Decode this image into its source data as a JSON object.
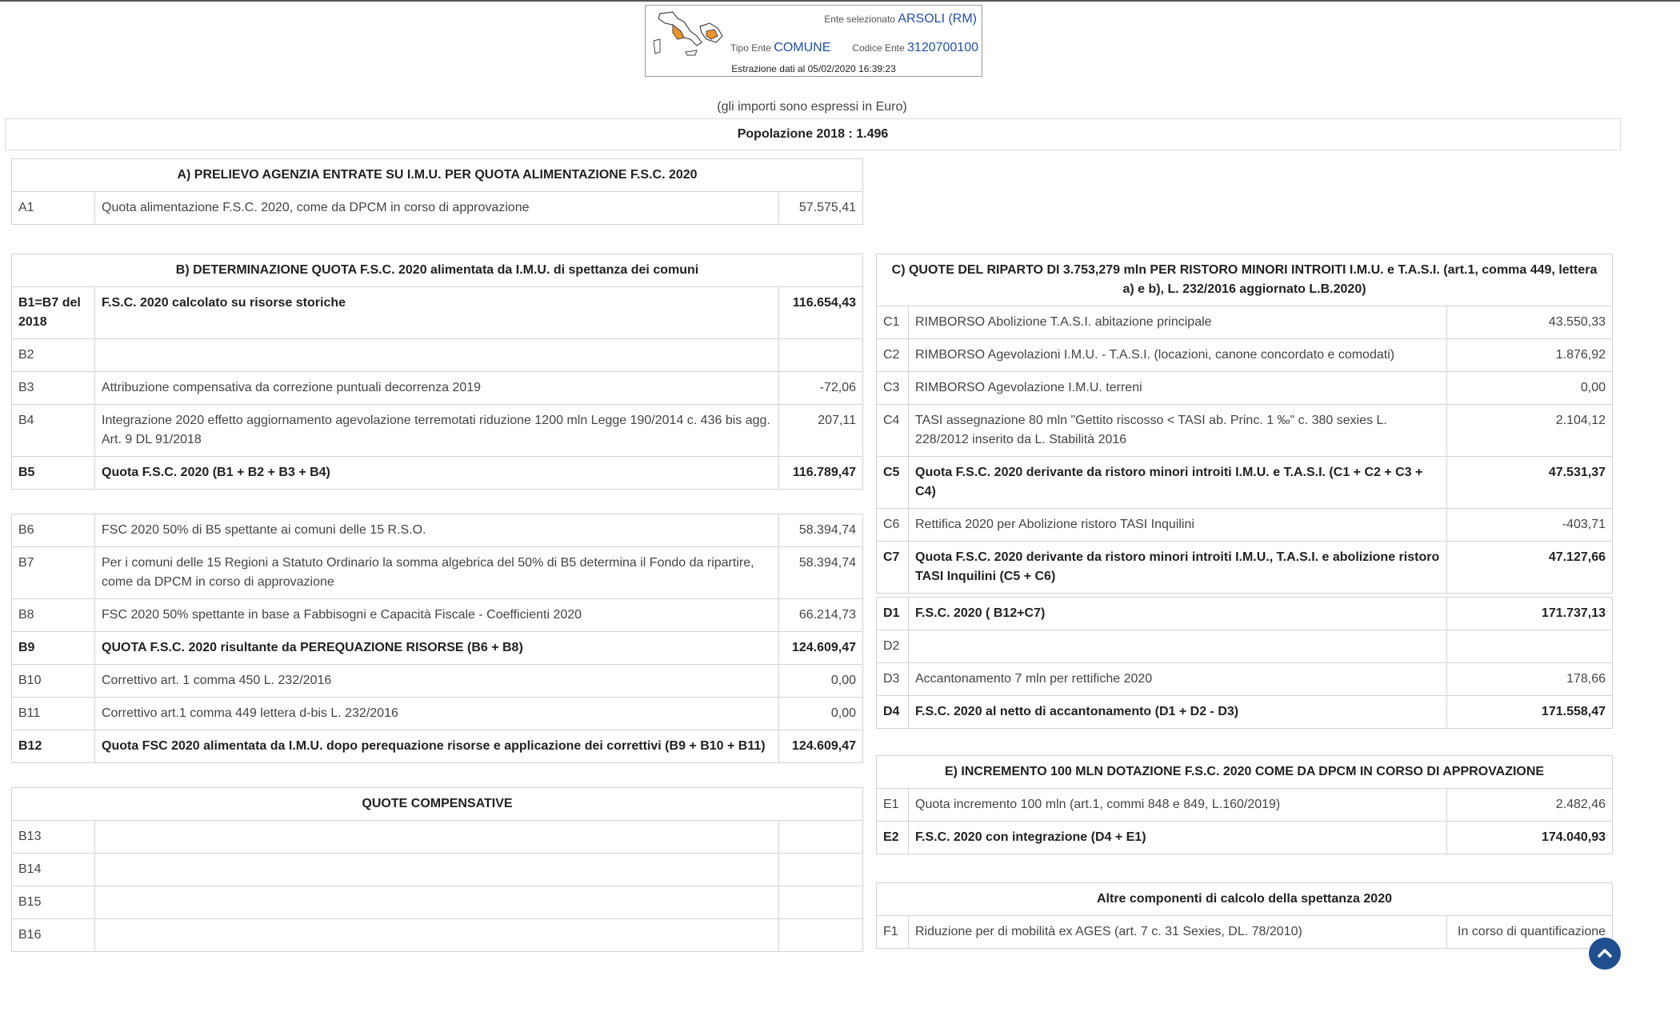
{
  "header": {
    "ente_label": "Ente selezionato",
    "ente_value": "ARSOLI (RM)",
    "tipo_label": "Tipo Ente",
    "tipo_value": "COMUNE",
    "codice_label": "Codice Ente",
    "codice_value": "3120700100",
    "estrazione": "Estrazione dati al 05/02/2020 16:39:23"
  },
  "note": "(gli importi sono espressi in Euro)",
  "popolazione": "Popolazione 2018 : 1.496",
  "section_a": {
    "title": "A) PRELIEVO AGENZIA ENTRATE SU I.M.U. PER QUOTA ALIMENTAZIONE F.S.C. 2020",
    "rows": [
      {
        "code": "A1",
        "desc": "Quota alimentazione F.S.C. 2020, come da DPCM in corso di approvazione",
        "value": "57.575,41"
      }
    ]
  },
  "section_b": {
    "title": "B) DETERMINAZIONE QUOTA F.S.C. 2020 alimentata da I.M.U. di spettanza dei comuni",
    "rows": [
      {
        "code": "B1=B7 del 2018",
        "desc": "F.S.C. 2020 calcolato su risorse storiche",
        "value": "116.654,43"
      },
      {
        "code": "B2",
        "desc": "",
        "value": ""
      },
      {
        "code": "B3",
        "desc": "Attribuzione compensativa da correzione puntuali decorrenza 2019",
        "value": "-72,06"
      },
      {
        "code": "B4",
        "desc": "Integrazione 2020 effetto aggiornamento agevolazione terremotati riduzione 1200 mln Legge 190/2014 c. 436 bis agg. Art. 9 DL 91/2018",
        "value": "207,11"
      },
      {
        "code": "B5",
        "desc": "Quota F.S.C. 2020 (B1 + B2 + B3 + B4)",
        "value": "116.789,47"
      },
      {
        "code": "B6",
        "desc": "FSC 2020 50% di B5 spettante ai comuni delle 15 R.S.O.",
        "value": "58.394,74"
      },
      {
        "code": "B7",
        "desc": "Per i comuni delle 15 Regioni a Statuto Ordinario la somma algebrica del 50% di B5 determina il Fondo da ripartire, come da DPCM in corso di approvazione",
        "value": "58.394,74"
      },
      {
        "code": "B8",
        "desc": "FSC 2020 50% spettante in base a Fabbisogni e Capacità Fiscale - Coefficienti 2020",
        "value": "66.214,73"
      },
      {
        "code": "B9",
        "desc": "QUOTA F.S.C. 2020 risultante da PEREQUAZIONE RISORSE (B6 + B8)",
        "value": "124.609,47"
      },
      {
        "code": "B10",
        "desc": "Correttivo art. 1 comma 450 L. 232/2016",
        "value": "0,00"
      },
      {
        "code": "B11",
        "desc": "Correttivo art.1 comma 449 lettera d-bis L. 232/2016",
        "value": "0,00"
      },
      {
        "code": "B12",
        "desc": "Quota FSC 2020 alimentata da I.M.U. dopo perequazione risorse e applicazione dei correttivi (B9 + B10 + B11)",
        "value": "124.609,47"
      }
    ]
  },
  "section_qc": {
    "title": "QUOTE COMPENSATIVE",
    "rows": [
      {
        "code": "B13",
        "desc": "",
        "value": ""
      },
      {
        "code": "B14",
        "desc": "",
        "value": ""
      },
      {
        "code": "B15",
        "desc": "",
        "value": ""
      },
      {
        "code": "B16",
        "desc": "",
        "value": ""
      }
    ]
  },
  "section_c": {
    "title": "C) QUOTE DEL RIPARTO DI 3.753,279 mln PER RISTORO MINORI INTROITI I.M.U. e T.A.S.I. (art.1, comma 449, lettera a) e b), L. 232/2016 aggiornato L.B.2020)",
    "rows": [
      {
        "code": "C1",
        "desc": "RIMBORSO Abolizione T.A.S.I. abitazione principale",
        "value": "43.550,33"
      },
      {
        "code": "C2",
        "desc": "RIMBORSO Agevolazioni I.M.U. - T.A.S.I. (locazioni, canone concordato e comodati)",
        "value": "1.876,92"
      },
      {
        "code": "C3",
        "desc": "RIMBORSO Agevolazione I.M.U. terreni",
        "value": "0,00"
      },
      {
        "code": "C4",
        "desc": "TASI assegnazione 80 mln \"Gettito riscosso < TASI ab. Princ. 1 ‰\" c. 380 sexies L. 228/2012 inserito da L. Stabilità 2016",
        "value": "2.104,12"
      },
      {
        "code": "C5",
        "desc": "Quota F.S.C. 2020 derivante da ristoro minori introiti I.M.U. e T.A.S.I. (C1 + C2 + C3 + C4)",
        "value": "47.531,37"
      },
      {
        "code": "C6",
        "desc": "Rettifica 2020 per Abolizione ristoro TASI Inquilini",
        "value": "-403,71"
      },
      {
        "code": "C7",
        "desc": "Quota F.S.C. 2020 derivante da ristoro minori introiti I.M.U., T.A.S.I. e abolizione ristoro TASI Inquilini (C5 + C6)",
        "value": "47.127,66"
      }
    ]
  },
  "section_d": {
    "rows": [
      {
        "code": "D1",
        "desc": "F.S.C. 2020 ( B12+C7)",
        "value": "171.737,13"
      },
      {
        "code": "D2",
        "desc": "",
        "value": ""
      },
      {
        "code": "D3",
        "desc": "Accantonamento 7 mln per rettifiche 2020",
        "value": "178,66"
      },
      {
        "code": "D4",
        "desc": "F.S.C. 2020 al netto di accantonamento (D1 + D2 - D3)",
        "value": "171.558,47"
      }
    ]
  },
  "section_e": {
    "title": "E) INCREMENTO 100 MLN DOTAZIONE F.S.C. 2020 COME DA DPCM IN CORSO DI APPROVAZIONE",
    "rows": [
      {
        "code": "E1",
        "desc": "Quota incremento 100 mln (art.1, commi 848 e 849, L.160/2019)",
        "value": "2.482,46"
      },
      {
        "code": "E2",
        "desc": "F.S.C. 2020 con integrazione (D4 + E1)",
        "value": "174.040,93"
      }
    ]
  },
  "section_f": {
    "title": "Altre componenti di calcolo della spettanza 2020",
    "rows": [
      {
        "code": "F1",
        "desc": "Riduzione per di mobilità ex AGES (art. 7 c. 31 Sexies, DL. 78/2010)",
        "value": "In corso di quantificazione"
      }
    ]
  },
  "icons": {
    "scroll_top": "chevron-up-icon",
    "logo": "italy-map-icon"
  },
  "colors": {
    "accent": "#1f4fa8",
    "scroll_button": "#1f4f8f",
    "map_highlight": "#f0922b"
  }
}
